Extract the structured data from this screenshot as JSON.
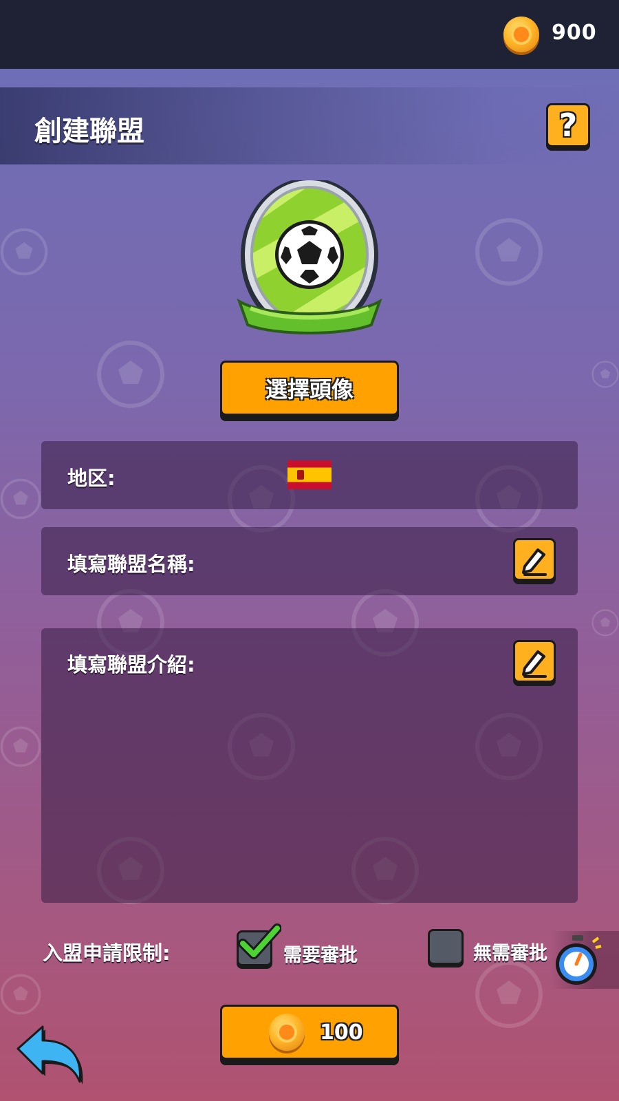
{
  "header": {
    "coin_count": "900",
    "coin_icon": "gold-coin-icon"
  },
  "title_bar": {
    "title": "創建聯盟",
    "help_label": "?"
  },
  "avatar": {
    "badge_icon": "soccer-ball-badge-icon",
    "select_label": "選擇頭像"
  },
  "form": {
    "region_label": "地区:",
    "region_flag": "spain-flag-icon",
    "name_label": "填寫聯盟名稱:",
    "intro_label": "填寫聯盟介紹:",
    "edit_icon": "pencil-edit-icon"
  },
  "join_restriction": {
    "label": "入盟申請限制:",
    "options": [
      {
        "label": "需要審批",
        "checked": true
      },
      {
        "label": "無需審批",
        "checked": false
      }
    ],
    "stopwatch_icon": "stopwatch-icon"
  },
  "create": {
    "cost": "100"
  },
  "colors": {
    "accent_orange": "#ffa100",
    "topbar": "#1f2235",
    "check_green": "#4ed334"
  }
}
